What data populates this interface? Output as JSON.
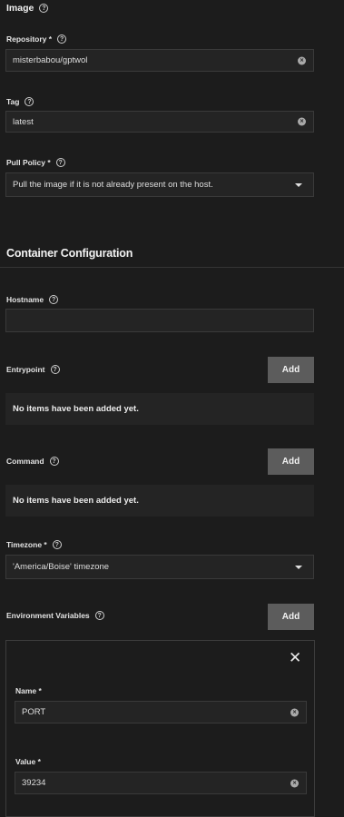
{
  "image_section": {
    "title": "Image",
    "repository": {
      "label": "Repository *",
      "value": "misterbabou/gptwol"
    },
    "tag": {
      "label": "Tag",
      "value": "latest"
    },
    "pull_policy": {
      "label": "Pull Policy *",
      "value": "Pull the image if it is not already present on the host."
    }
  },
  "container_section": {
    "title": "Container Configuration",
    "hostname": {
      "label": "Hostname",
      "value": ""
    },
    "entrypoint": {
      "label": "Entrypoint",
      "add_label": "Add",
      "empty_text": "No items have been added yet."
    },
    "command": {
      "label": "Command",
      "add_label": "Add",
      "empty_text": "No items have been added yet."
    },
    "timezone": {
      "label": "Timezone *",
      "value": "'America/Boise' timezone"
    },
    "env_vars": {
      "label": "Environment Variables",
      "add_label": "Add",
      "items": [
        {
          "name_label": "Name *",
          "name_value": "PORT",
          "value_label": "Value *",
          "value_value": "39234"
        }
      ]
    }
  },
  "icons": {
    "help": "help-circle-icon",
    "clear": "clear-icon",
    "dropdown": "chevron-down-icon",
    "close": "close-icon"
  },
  "glyphs": {
    "help": "?",
    "clear": "×",
    "close": "✕"
  }
}
